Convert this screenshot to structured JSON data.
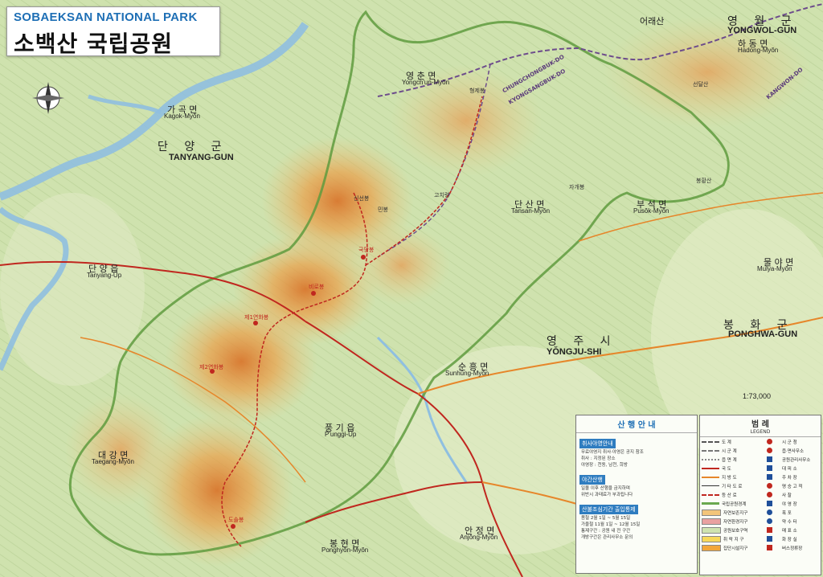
{
  "title": {
    "english": "SOBAEKSAN NATIONAL PARK",
    "korean": "소백산 국립공원"
  },
  "scale_text": "1:73,000",
  "places": [
    {
      "ko": "영 월 군",
      "en": "YONGWOL-GUN"
    },
    {
      "ko": "하 동 면",
      "en": "Hadong-Myŏn"
    },
    {
      "ko": "어래산",
      "en": ""
    },
    {
      "ko": "영 춘 면",
      "en": "Yongch'un-Myŏn"
    },
    {
      "ko": "가 곡 면",
      "en": "Kagok-Myŏn"
    },
    {
      "ko": "단 양 군",
      "en": "TANYANG-GUN"
    },
    {
      "ko": "단 양 읍",
      "en": "Tanyang-Ŭp"
    },
    {
      "ko": "단 산 면",
      "en": "Tansan-Myŏn"
    },
    {
      "ko": "부 석 면",
      "en": "Pusŏk-Myŏn"
    },
    {
      "ko": "물 야 면",
      "en": "Mulya-Myŏn"
    },
    {
      "ko": "봉 화 군",
      "en": "PONGHWA-GUN"
    },
    {
      "ko": "영 주 시",
      "en": "YŎNGJU-SHI"
    },
    {
      "ko": "순 흥 면",
      "en": "Sunhŭng-Myŏn"
    },
    {
      "ko": "풍 기 읍",
      "en": "P'unggi-Ŭp"
    },
    {
      "ko": "대 강 면",
      "en": "Taegang-Myŏn"
    },
    {
      "ko": "안 정 면",
      "en": "Anjŏng-Myŏn"
    },
    {
      "ko": "봉 현 면",
      "en": "Ponghyŏn-Myŏn"
    }
  ],
  "peaks": [
    {
      "ko": "국망봉"
    },
    {
      "ko": "비로봉"
    },
    {
      "ko": "제1연화봉"
    },
    {
      "ko": "제2연화봉"
    },
    {
      "ko": "도솔봉"
    },
    {
      "ko": "형제봉"
    },
    {
      "ko": "선달산"
    },
    {
      "ko": "신선봉"
    },
    {
      "ko": "민봉"
    },
    {
      "ko": "고치령"
    },
    {
      "ko": "자개봉"
    },
    {
      "ko": "봉황산"
    }
  ],
  "province_boundary_text": {
    "chungbuk": "CHUNGCHONGBUK-DO",
    "gyeongbuk": "KYONGSANGBUK-DO",
    "gangwon": "KANGWON-DO"
  },
  "info_panel": {
    "title": "산 행 안 내",
    "sections": [
      {
        "heading": "취사야영안내",
        "lines": [
          "무료야영지 취사·야영은 공지 참조",
          "취사 : 지정된 장소",
          "야영장 : 천동, 남천, 희방"
        ]
      },
      {
        "heading": "야간산행",
        "lines": [
          "일몰 이후 산행을 금지하며",
          "위반시 과태료가 부과됩니다"
        ]
      },
      {
        "heading": "산불조심기간 출입통제",
        "lines": [
          "봄철 2월 1일 ~ 5월 15일",
          "가을철 11월 1일 ~ 12월 15일",
          "통제구간 : 공원 내 전 구간",
          "개방구간은 관리사무소 문의"
        ]
      }
    ]
  },
  "legend": {
    "title": "범 례",
    "subtitle": "LEGEND",
    "left": [
      {
        "label": "도 계",
        "color": "#555555",
        "style": "dash"
      },
      {
        "label": "시 군 계",
        "color": "#777777",
        "style": "dash"
      },
      {
        "label": "읍 면 계",
        "color": "#888888",
        "style": "dot"
      },
      {
        "label": "국 도",
        "color": "#c0271f",
        "style": "solid"
      },
      {
        "label": "지 방 도",
        "color": "#e6862a",
        "style": "solid"
      },
      {
        "label": "기 타 도 로",
        "color": "#333333",
        "style": "thin"
      },
      {
        "label": "등 산 로",
        "color": "#c0271f",
        "style": "dash"
      },
      {
        "label": "국립공원경계",
        "color": "#6aa84f",
        "style": "thick"
      },
      {
        "label": "자연보존지구",
        "color": "#f3c57a",
        "style": "fill"
      },
      {
        "label": "자연환경지구",
        "color": "#e9a1a1",
        "style": "fill"
      },
      {
        "label": "공원보호구역",
        "color": "#cfe3b0",
        "style": "fill"
      },
      {
        "label": "취 락 지 구",
        "color": "#f7d85a",
        "style": "fill"
      },
      {
        "label": "집단시설지구",
        "color": "#f2a63a",
        "style": "fill"
      }
    ],
    "right": [
      {
        "label": "시 군 청",
        "color": "#c0271f",
        "style": "circle"
      },
      {
        "label": "읍·면사무소",
        "color": "#c0271f",
        "style": "circle"
      },
      {
        "label": "공원관리사무소",
        "color": "#1f4f9a",
        "style": "square"
      },
      {
        "label": "대 피 소",
        "color": "#1f4f9a",
        "style": "square"
      },
      {
        "label": "주 차 장",
        "color": "#1f4f9a",
        "style": "square"
      },
      {
        "label": "명 승 고 적",
        "color": "#c0271f",
        "style": "circle"
      },
      {
        "label": "사 찰",
        "color": "#c0271f",
        "style": "circle"
      },
      {
        "label": "야 영 장",
        "color": "#1f4f9a",
        "style": "square"
      },
      {
        "label": "폭 포",
        "color": "#1f4f9a",
        "style": "circle"
      },
      {
        "label": "약 수 터",
        "color": "#1f4f9a",
        "style": "circle"
      },
      {
        "label": "매 표 소",
        "color": "#c0271f",
        "style": "square"
      },
      {
        "label": "화 장 실",
        "color": "#1f4f9a",
        "style": "square"
      },
      {
        "label": "버스정류장",
        "color": "#c0271f",
        "style": "square"
      }
    ]
  }
}
